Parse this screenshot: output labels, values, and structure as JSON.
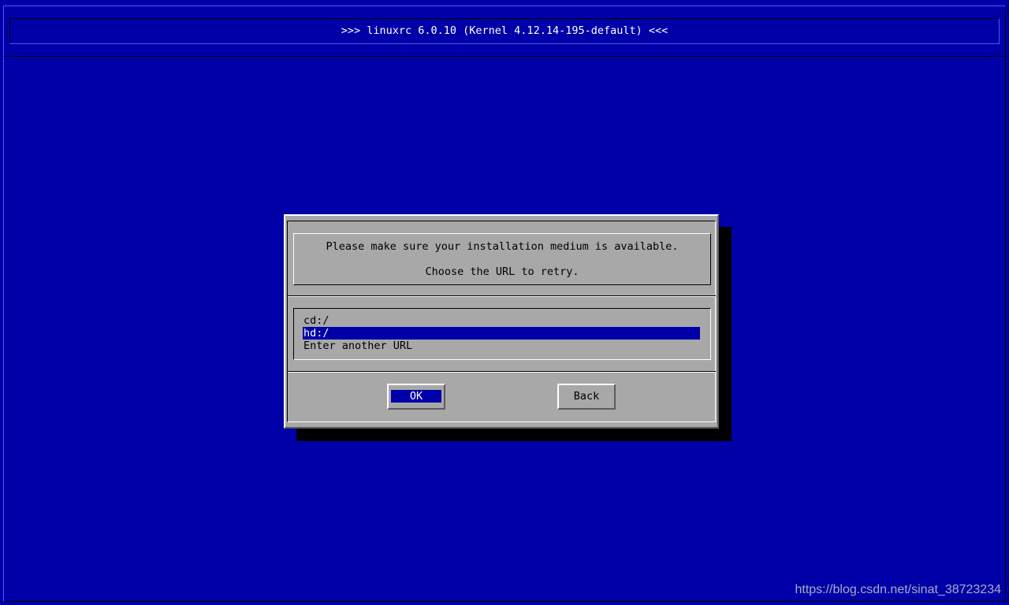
{
  "header": {
    "title": ">>> linuxrc 6.0.10 (Kernel 4.12.14-195-default) <<<"
  },
  "dialog": {
    "message_line_1": "Please make sure your installation medium is available.",
    "message_line_2": "Choose the URL to retry.",
    "options": [
      {
        "label": "cd:/",
        "selected": false
      },
      {
        "label": "hd:/",
        "selected": true
      },
      {
        "label": "Enter another URL",
        "selected": false
      }
    ],
    "ok_label": "OK",
    "back_label": "Back"
  },
  "watermark": {
    "text": "https://blog.csdn.net/sinat_38723234"
  },
  "colors": {
    "background": "#0000a8",
    "dialog_bg": "#a8a8a8",
    "highlight": "#0000a8",
    "text_on_highlight": "#ffffff"
  }
}
